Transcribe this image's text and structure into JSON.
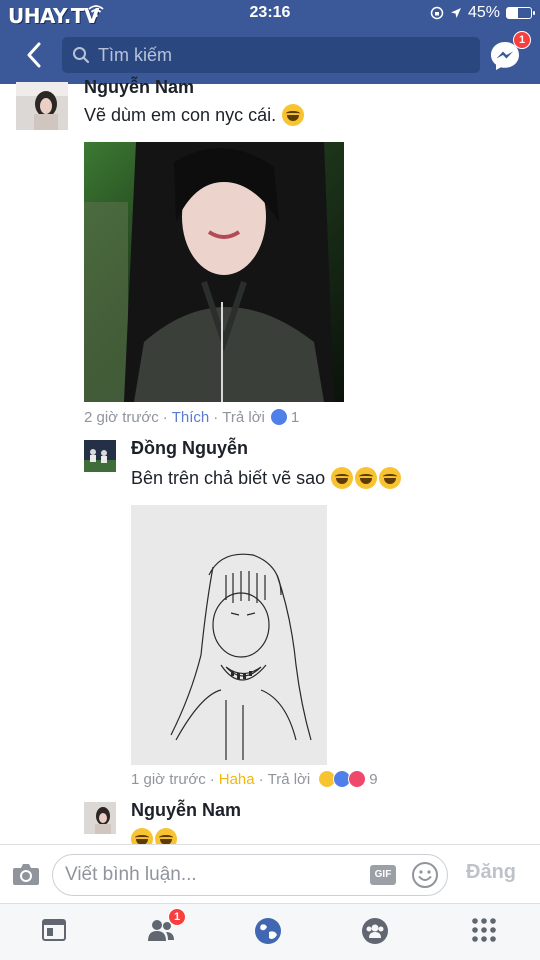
{
  "status_bar": {
    "watermark": "UHAY.TV",
    "time": "23:16",
    "battery": "45%"
  },
  "header": {
    "search_placeholder": "Tìm kiếm",
    "messenger_badge": "1"
  },
  "comments": [
    {
      "author": "Nguyễn Nam",
      "text": "Vẽ dùm em con nyc cái.",
      "emoji_count": 1,
      "time": "2 giờ trước",
      "reaction_label": "Thích",
      "reply_label": "Trả lời",
      "reaction_count": "1"
    },
    {
      "author": "Đồng Nguyễn",
      "text": "Bên trên chả biết vẽ sao",
      "emoji_count": 3,
      "time": "1 giờ trước",
      "reaction_label": "Haha",
      "reply_label": "Trả lời",
      "reaction_count": "9"
    },
    {
      "author": "Nguyễn Nam",
      "text": "",
      "emoji_count": 2
    }
  ],
  "composer": {
    "placeholder": "Viết bình luận...",
    "gif_label": "GIF",
    "post_label": "Đăng"
  },
  "tabbar": {
    "friends_badge": "1"
  },
  "colors": {
    "brand": "#3b5998",
    "like": "#5b7bd5",
    "haha": "#f0b90b",
    "badge": "#fa3e3e"
  }
}
